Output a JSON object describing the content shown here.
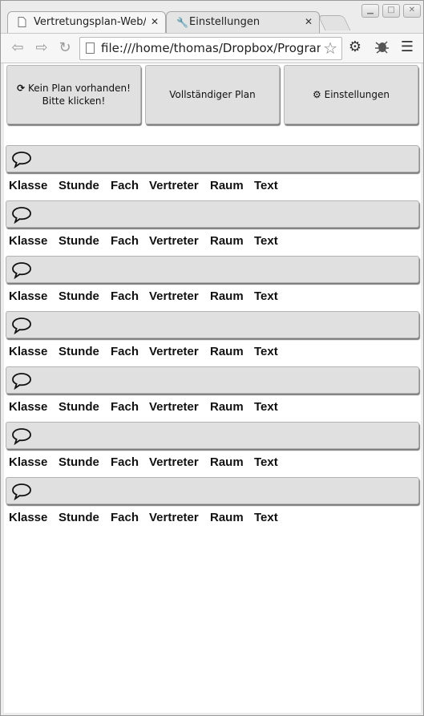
{
  "window": {
    "controls": [
      "minimize",
      "maximize",
      "close"
    ]
  },
  "tabs": [
    {
      "title": "Vertretungsplan-Web/",
      "icon": "page-icon",
      "active": true
    },
    {
      "title": "Einstellungen",
      "icon": "wrench-icon",
      "active": false
    }
  ],
  "toolbar": {
    "url": "file:///home/thomas/Dropbox/Programmi",
    "icons": [
      "back-icon",
      "forward-icon",
      "reload-icon",
      "star-icon",
      "settings-gear-icon",
      "extension-icon",
      "menu-icon"
    ]
  },
  "buttons": {
    "refresh_line1": "Kein Plan vorhanden!",
    "refresh_line2": "Bitte klicken!",
    "full_plan": "Vollständiger Plan",
    "settings": "Einstellungen"
  },
  "table_header": [
    "Klasse",
    "Stunde",
    "Fach",
    "Vertreter",
    "Raum",
    "Text"
  ],
  "sections": [
    {
      "icon": "speech-bubble-icon"
    },
    {
      "icon": "speech-bubble-icon"
    },
    {
      "icon": "speech-bubble-icon"
    },
    {
      "icon": "speech-bubble-icon"
    },
    {
      "icon": "speech-bubble-icon"
    },
    {
      "icon": "speech-bubble-icon"
    },
    {
      "icon": "speech-bubble-icon"
    }
  ]
}
